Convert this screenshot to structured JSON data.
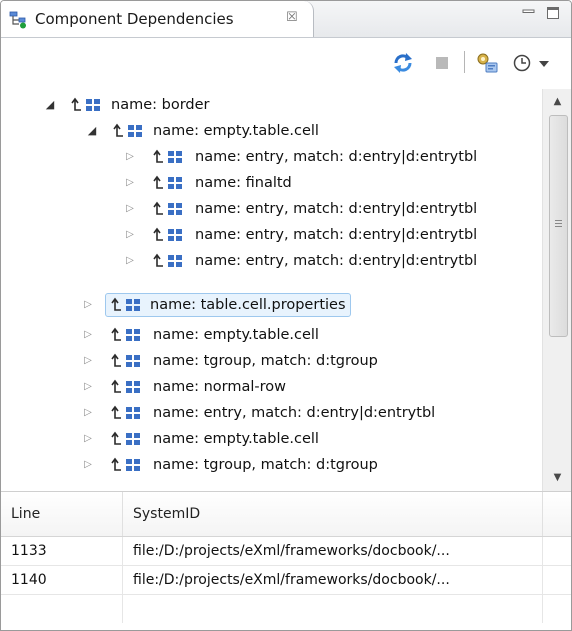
{
  "view": {
    "title": "Component Dependencies",
    "close_glyph": "☒"
  },
  "toolbar": {
    "buttons": [
      {
        "name": "refresh-icon"
      },
      {
        "name": "stop-icon"
      },
      {
        "name": "configure-scripts-icon"
      },
      {
        "name": "history-menu-icon"
      }
    ]
  },
  "tree": {
    "rows": [
      {
        "label": "name: border",
        "expanded": true,
        "level": 0
      },
      {
        "label": "name: empty.table.cell",
        "expanded": true,
        "level": 1
      },
      {
        "label": "name: entry,  match: d:entry|d:entrytbl",
        "expanded": false,
        "level": 2
      },
      {
        "label": "name: finaltd",
        "expanded": false,
        "level": 2
      },
      {
        "label": "name: entry,  match: d:entry|d:entrytbl",
        "expanded": false,
        "level": 2
      },
      {
        "label": "name: entry,  match: d:entry|d:entrytbl",
        "expanded": false,
        "level": 2
      },
      {
        "label": "name: entry,  match: d:entry|d:entrytbl",
        "expanded": false,
        "level": 2
      },
      {
        "label": "name: table.cell.properties",
        "expanded": false,
        "level": 1,
        "selected": true
      },
      {
        "label": "name: empty.table.cell",
        "expanded": false,
        "level": 1
      },
      {
        "label": "name: tgroup,  match: d:tgroup",
        "expanded": false,
        "level": 1
      },
      {
        "label": "name: normal-row",
        "expanded": false,
        "level": 1
      },
      {
        "label": "name: entry,  match: d:entry|d:entrytbl",
        "expanded": false,
        "level": 1
      },
      {
        "label": "name: empty.table.cell",
        "expanded": false,
        "level": 1
      },
      {
        "label": "name: tgroup,  match: d:tgroup",
        "expanded": false,
        "level": 1
      }
    ]
  },
  "references_table": {
    "columns": [
      "Line",
      "SystemID"
    ],
    "rows": [
      {
        "line": "1133",
        "system_id": "file:/D:/projects/eXml/frameworks/docbook/..."
      },
      {
        "line": "1140",
        "system_id": "file:/D:/projects/eXml/frameworks/docbook/..."
      }
    ]
  },
  "colors": {
    "selection_bg": "#e8f3fd",
    "selection_border": "#9ec8ee",
    "node_icon_blue": "#3a6fc4",
    "arrow_dark": "#2b2b2b"
  }
}
